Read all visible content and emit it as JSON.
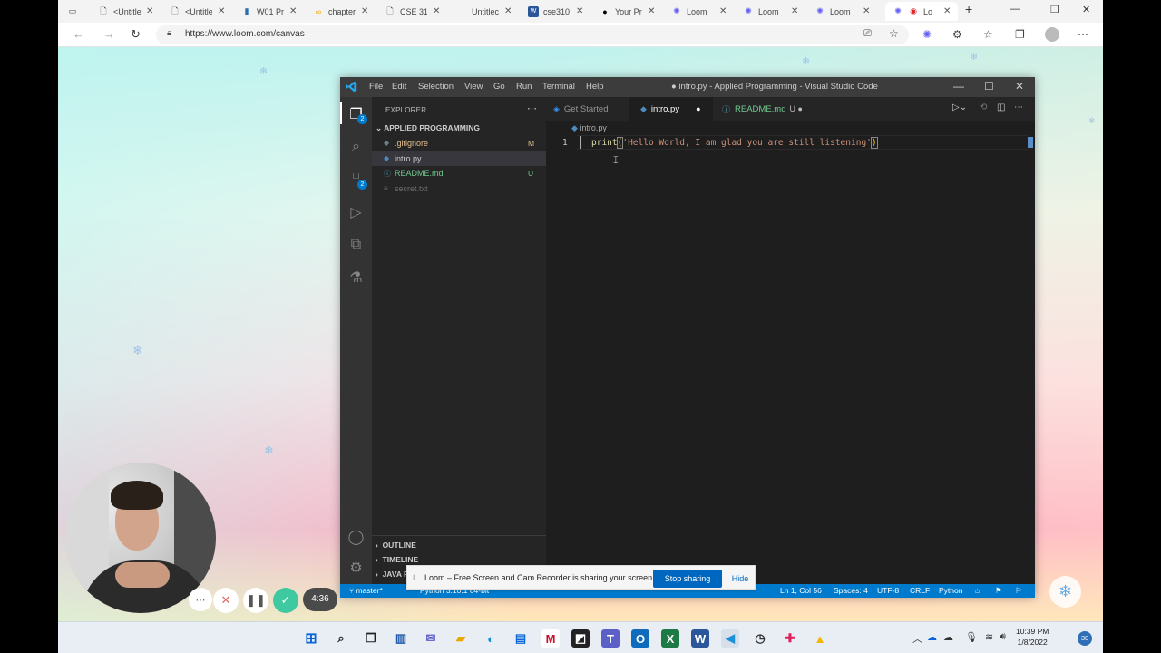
{
  "browser": {
    "tabs": [
      {
        "title": "<Untitle",
        "icon": "page-icon"
      },
      {
        "title": "<Untitle",
        "icon": "page-icon"
      },
      {
        "title": "W01 Pr",
        "icon": "chart-icon"
      },
      {
        "title": "chapter",
        "icon": "colab-icon"
      },
      {
        "title": "CSE 31",
        "icon": "page-icon"
      },
      {
        "title": "Untitlec",
        "icon": "page-icon"
      },
      {
        "title": "cse310",
        "icon": "word-icon"
      },
      {
        "title": "Your Pr",
        "icon": "github-icon"
      },
      {
        "title": "Loom",
        "icon": "loom-icon"
      },
      {
        "title": "Loom",
        "icon": "loom-icon"
      },
      {
        "title": "Loom",
        "icon": "loom-icon"
      },
      {
        "title": "Lo",
        "icon": "loom-icon"
      }
    ],
    "url": "https://www.loom.com/canvas"
  },
  "vscode": {
    "menu": [
      "File",
      "Edit",
      "Selection",
      "View",
      "Go",
      "Run",
      "Terminal",
      "Help"
    ],
    "window_title": "● intro.py - Applied Programming - Visual Studio Code",
    "explorer": {
      "title": "EXPLORER",
      "project": "APPLIED PROGRAMMING",
      "files": [
        {
          "name": ".gitignore",
          "status": "M",
          "color": "#e2c08d"
        },
        {
          "name": "intro.py",
          "status": "",
          "color": "#cccccc"
        },
        {
          "name": "README.md",
          "status": "U",
          "color": "#73c991"
        },
        {
          "name": "secret.txt",
          "status": "",
          "color": "#6e6e6e"
        }
      ],
      "sections": [
        "OUTLINE",
        "TIMELINE",
        "JAVA P"
      ]
    },
    "badges": {
      "explorer": "2",
      "scm": "2"
    },
    "tabs": [
      {
        "label": "Get Started",
        "modified": ""
      },
      {
        "label": "intro.py",
        "modified": "●"
      },
      {
        "label": "README.md",
        "modified": "U ●"
      }
    ],
    "breadcrumb": "intro.py",
    "code": {
      "line_number": "1",
      "func": "print",
      "open": "(",
      "string": "'Hello World, I am glad you are still listening'",
      "close": ")"
    },
    "status": {
      "branch": "master*",
      "python": "Python 3.10.1 64-bit",
      "position": "Ln 1, Col 56",
      "spaces": "Spaces: 4",
      "encoding": "UTF-8",
      "eol": "CRLF",
      "language": "Python"
    }
  },
  "loom": {
    "share_text": "Loom – Free Screen and Cam Recorder is sharing your screen.",
    "stop_label": "Stop sharing",
    "hide_label": "Hide",
    "timer": "4:36"
  },
  "taskbar": {
    "time": "10:39 PM",
    "date": "1/8/2022",
    "notifications": "30"
  },
  "colors": {
    "vscode_blue": "#007acc",
    "loom_green": "#3fc9a0"
  }
}
